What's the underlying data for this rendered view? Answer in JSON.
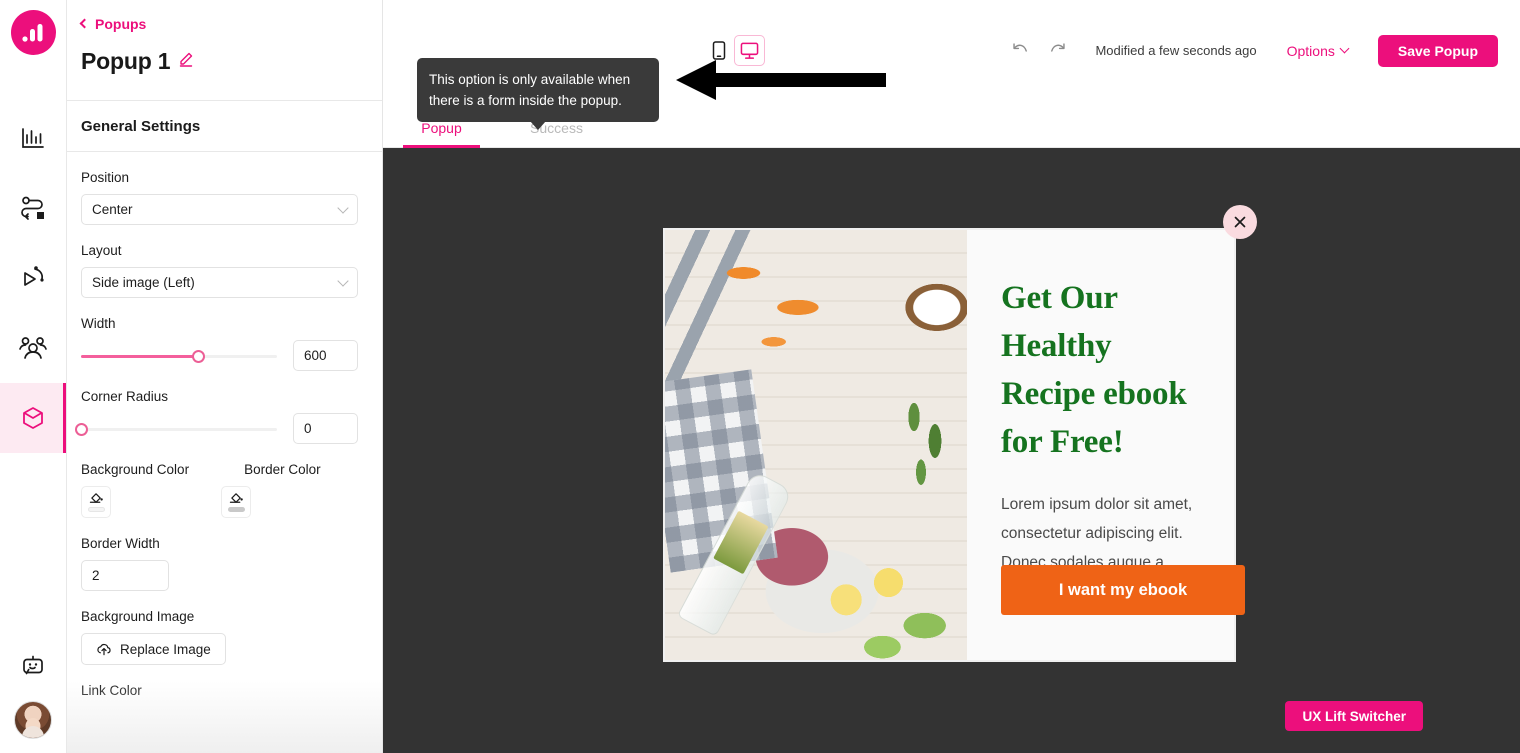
{
  "app": {
    "logo_icon": "bar-chart-logo-icon",
    "brand_pink": "#ec0f7c",
    "canvas_bg": "#333333"
  },
  "sidebar": {
    "items": [
      {
        "icon": "analytics-bar-chart-icon",
        "name": "analytics",
        "active": false
      },
      {
        "icon": "journey-flow-icon",
        "name": "journeys",
        "active": false
      },
      {
        "icon": "campaign-rocket-icon",
        "name": "campaigns",
        "active": false
      },
      {
        "icon": "audience-people-icon",
        "name": "audience",
        "active": false
      },
      {
        "icon": "package-box-icon",
        "name": "popups",
        "active": true
      }
    ],
    "bottom": [
      {
        "icon": "chat-bot-smiley-icon",
        "name": "support-bot"
      },
      {
        "icon": "user-avatar",
        "name": "account-avatar"
      }
    ]
  },
  "panel": {
    "breadcrumb": "Popups",
    "breadcrumb_icon": "chevron-left-icon",
    "title": "Popup 1",
    "edit_icon": "pencil-edit-icon",
    "section_title": "General Settings",
    "fields": {
      "position": {
        "label": "Position",
        "value": "Center",
        "icon": "chevron-down-icon"
      },
      "layout": {
        "label": "Layout",
        "value": "Side image (Left)",
        "icon": "chevron-down-icon"
      },
      "width": {
        "label": "Width",
        "value": "600",
        "slider_percent": 60
      },
      "corner_radius": {
        "label": "Corner Radius",
        "value": "0",
        "slider_percent": 0
      },
      "background_color": {
        "label": "Background Color",
        "icon": "paint-bucket-icon",
        "swatch": "#ffffff"
      },
      "border_color": {
        "label": "Border Color",
        "icon": "paint-bucket-icon",
        "swatch": "#c9c9c9"
      },
      "border_width": {
        "label": "Border Width",
        "value": "2"
      },
      "background_image": {
        "label": "Background Image",
        "button": "Replace Image",
        "icon": "cloud-upload-icon"
      },
      "link_color": {
        "label": "Link Color"
      }
    }
  },
  "toolbar": {
    "devices": [
      {
        "name": "mobile-view",
        "icon": "mobile-phone-icon",
        "active": false
      },
      {
        "name": "desktop-view",
        "icon": "desktop-monitor-icon",
        "active": true
      }
    ],
    "undo_icon": "undo-arrow-icon",
    "redo_icon": "redo-arrow-icon",
    "modified": "Modified a few seconds ago",
    "options_label": "Options",
    "options_icon": "chevron-down-icon",
    "save_label": "Save Popup"
  },
  "tabs": [
    {
      "label": "Popup",
      "active": true,
      "disabled": false
    },
    {
      "label": "Success",
      "active": false,
      "disabled": true
    }
  ],
  "tooltip": {
    "text": "This option is only available when there is a form inside the popup."
  },
  "annotation": {
    "arrow_icon": "black-pointer-arrow-left",
    "color": "#000000"
  },
  "popup_preview": {
    "image_alt": "healthy-food-flat-lay-photo",
    "heading": "Get Our Healthy Recipe ebook for Free!",
    "heading_color": "#15731f",
    "body": "Lorem ipsum dolor sit amet, consectetur adipiscing elit. Donec sodales augue a laoreet.",
    "cta_label": "I want my ebook",
    "cta_color": "#ef6316",
    "close_icon": "close-x-icon"
  },
  "switcher": {
    "label": "UX Lift Switcher"
  }
}
